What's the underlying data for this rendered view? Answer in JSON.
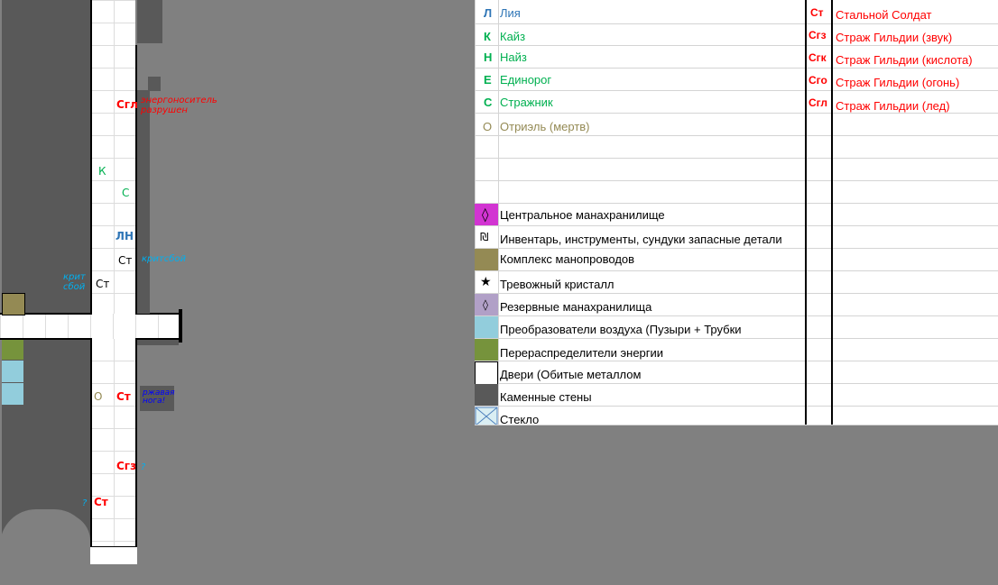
{
  "map": {
    "notes": {
      "energy_destroyed": "энергоноситель разрушен",
      "crit_fail_right": "критсбой",
      "crit_fail_left": "крит сбой",
      "rusty_leg": "ржавая нога!",
      "question": "?"
    },
    "markers": {
      "sgl": "Сгл",
      "k": "К",
      "s": "С",
      "ln": "ЛН",
      "st": "Ст",
      "o": "О",
      "sgz": "Сгз"
    }
  },
  "legend": {
    "allies": [
      {
        "code": "Л",
        "name": "Лия",
        "color": "#2e75b6"
      },
      {
        "code": "К",
        "name": "Кайз",
        "color": "#00b050"
      },
      {
        "code": "Н",
        "name": "Найз",
        "color": "#00b050"
      },
      {
        "code": "Е",
        "name": "Единорог",
        "color": "#00b050"
      },
      {
        "code": "С",
        "name": "Стражник",
        "color": "#00b050"
      },
      {
        "code": "О",
        "name": "Отриэль (мертв)",
        "color": "#948a54"
      }
    ],
    "enemies": [
      {
        "code": "Ст",
        "name": "Стальной Солдат"
      },
      {
        "code": "Сгз",
        "name": "Страж Гильдии (звук)"
      },
      {
        "code": "Сгк",
        "name": "Страж Гильдии (кислота)"
      },
      {
        "code": "Сго",
        "name": "Страж Гильдии (огонь)"
      },
      {
        "code": "Сгл",
        "name": "Страж Гильдии (лед)"
      }
    ],
    "enemy_color": "#ff0000",
    "symbols": [
      {
        "icon": "diamond-icon",
        "glyph": "◊",
        "label": "Центральное манахранилище",
        "color": "#d234d2"
      },
      {
        "icon": "sheqel-icon",
        "glyph": "₪",
        "label": "Инвентарь, инструменты, сундуки запасные детали",
        "color": "#ffffff"
      },
      {
        "icon": "swatch",
        "glyph": "",
        "label": "Комплекс манопроводов",
        "color": "#948a54"
      },
      {
        "icon": "star-icon",
        "glyph": "★",
        "label": "Тревожный кристалл",
        "color": "#ffffff"
      },
      {
        "icon": "small-diamond-icon",
        "glyph": "◊",
        "label": "Резервные манахранилища",
        "color": "#b1a0c7"
      },
      {
        "icon": "swatch",
        "glyph": "",
        "label": "Преобразователи воздуха (Пузыри + Трубки",
        "color": "#92cddc"
      },
      {
        "icon": "swatch",
        "glyph": "",
        "label": "Перераспределители энергии",
        "color": "#76933c"
      },
      {
        "icon": "swatch",
        "glyph": "",
        "label": "Двери (Обитые металлом",
        "color": "#ffffff"
      },
      {
        "icon": "swatch",
        "glyph": "",
        "label": "Каменные стены",
        "color": "#595959"
      },
      {
        "icon": "glass-icon",
        "glyph": "",
        "label": "Стекло",
        "color": "#daeef3"
      }
    ]
  }
}
